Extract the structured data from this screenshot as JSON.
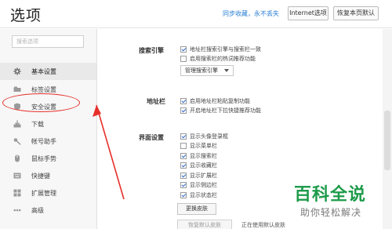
{
  "header": {
    "title": "选项",
    "sync_link": "同步收藏，永不丢失",
    "ie_button": "Internet选项",
    "reset_button": "恢复本页默认"
  },
  "sidebar": {
    "search_placeholder": "搜索选项",
    "items": [
      {
        "label": "基本设置",
        "icon": "gear-icon"
      },
      {
        "label": "标签设置",
        "icon": "tab-icon"
      },
      {
        "label": "安全设置",
        "icon": "shield-icon"
      },
      {
        "label": "下载",
        "icon": "download-icon"
      },
      {
        "label": "帐号助手",
        "icon": "key-icon"
      },
      {
        "label": "鼠标手势",
        "icon": "mouse-icon"
      },
      {
        "label": "快捷键",
        "icon": "keyboard-icon"
      },
      {
        "label": "扩展管理",
        "icon": "extension-icon"
      },
      {
        "label": "高级",
        "icon": "advanced-icon"
      }
    ]
  },
  "content": {
    "search_engine": {
      "title": "搜索引擎",
      "options": [
        {
          "label": "地址栏搜索引擎与搜索栏一致",
          "checked": true
        },
        {
          "label": "启用搜索栏的热词推荐功能",
          "checked": false
        }
      ],
      "manage_select": "管理搜索引擎"
    },
    "address_bar": {
      "title": "地址栏",
      "options": [
        {
          "label": "启用地址栏粘贴复制功能",
          "checked": true
        },
        {
          "label": "开启地址栏下拉快捷推荐功能",
          "checked": true
        }
      ]
    },
    "ui": {
      "title": "界面设置",
      "options": [
        {
          "label": "显示头像登录框",
          "checked": true
        },
        {
          "label": "显示菜单栏",
          "checked": false
        },
        {
          "label": "显示搜索栏",
          "checked": true
        },
        {
          "label": "显示收藏栏",
          "checked": true
        },
        {
          "label": "显示扩展栏",
          "checked": true
        },
        {
          "label": "显示侧边栏",
          "checked": true
        },
        {
          "label": "显示状态栏",
          "checked": true
        }
      ],
      "skin_button": "更换皮肤",
      "default_skin_button": "恢复默认皮肤",
      "using_text": "正在使用默认皮肤"
    }
  },
  "watermark": {
    "main": "百科全说",
    "sub": "助你轻松解决"
  },
  "colors": {
    "annotation": "#e5302a",
    "link": "#2a7fd4",
    "watermark": "#1e9b4a"
  }
}
